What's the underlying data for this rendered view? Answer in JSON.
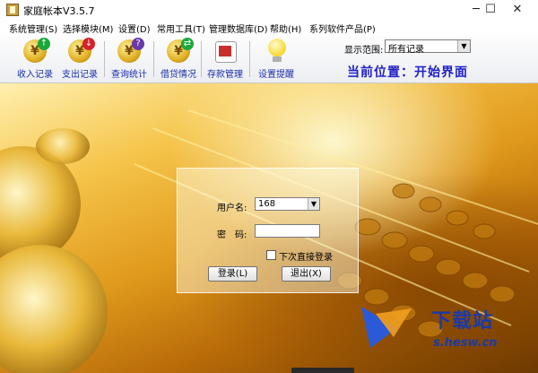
{
  "window": {
    "title": "家庭帐本V3.5.7",
    "min": "─",
    "max": "☐",
    "close": "✕"
  },
  "menu": [
    "系统管理(S)",
    "选择模块(M)",
    "设置(D)",
    "常用工具(T)",
    "管理数据库(D)",
    "帮助(H)",
    "系列软件产品(P)"
  ],
  "toolbar": {
    "income": "收入记录",
    "expense": "支出记录",
    "query": "查询统计",
    "loan": "借贷情况",
    "deposit": "存款管理",
    "reminder": "设置提醒"
  },
  "range": {
    "label": "显示范围:",
    "value": "所有记录"
  },
  "location": "当前位置：开始界面",
  "login": {
    "user_label": "用户名:",
    "user_value": "168",
    "pwd_label": "密　码:",
    "remember_label": "下次直接登录",
    "login_button": "登录(L)",
    "exit_button": "退出(X)"
  },
  "watermark": {
    "brand": "下载站",
    "url": "s.hesw.cn"
  },
  "colors": {
    "toolbar_label": "#1a2fa8",
    "location": "#2020c8",
    "scene": "#e09a1c"
  }
}
